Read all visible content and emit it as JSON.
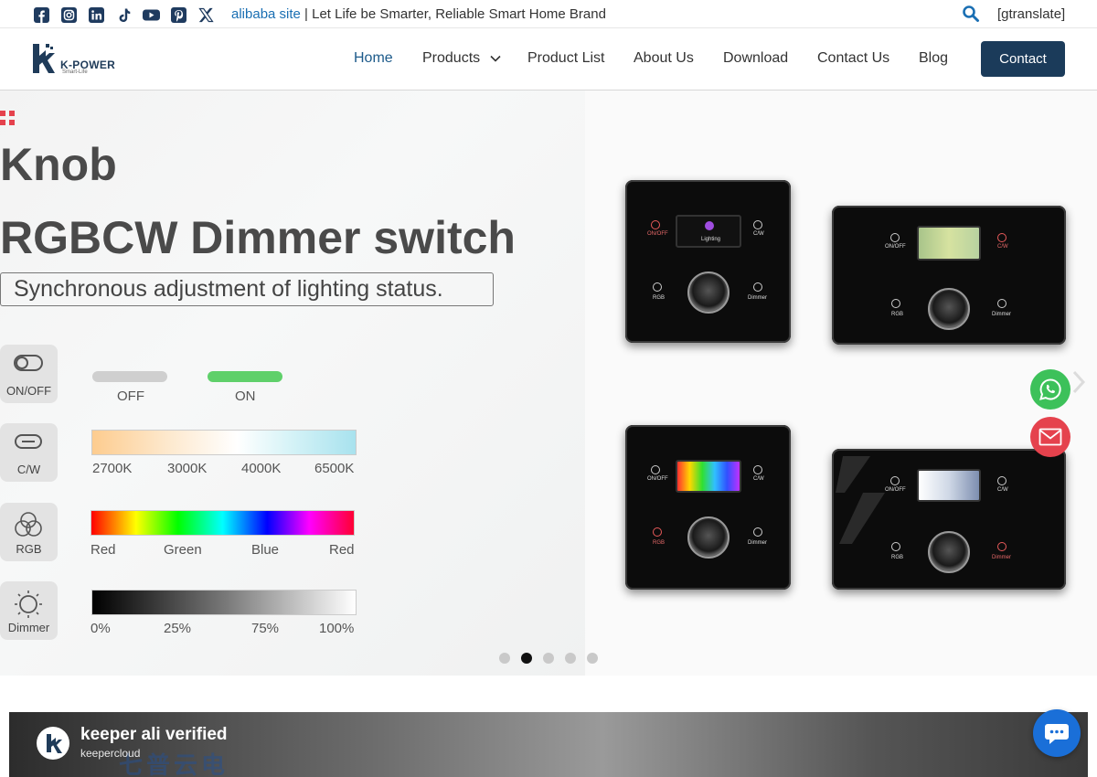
{
  "topbar": {
    "social_icons": [
      "facebook-icon",
      "instagram-icon",
      "linkedin-icon",
      "tiktok-icon",
      "youtube-icon",
      "pinterest-icon",
      "x-icon"
    ],
    "link_text": "alibaba site",
    "separator": " | ",
    "tagline": "Let Life be Smarter, Reliable Smart Home Brand",
    "translate": "[gtranslate]"
  },
  "header": {
    "logo_text": "K-POWER",
    "logo_sub": "Smart-Life",
    "nav": [
      "Home",
      "Products",
      "Product List",
      "About Us",
      "Download",
      "Contact Us",
      "Blog"
    ],
    "active_nav": "Home",
    "contact_button": "Contact"
  },
  "hero": {
    "line1": "Knob",
    "line2": "RGBCW Dimmer switch",
    "subtitle": "Synchronous adjustment of lighting status.",
    "features": [
      {
        "label": "ON/OFF"
      },
      {
        "label": "C/W"
      },
      {
        "label": "RGB"
      },
      {
        "label": "Dimmer"
      }
    ],
    "onoff": {
      "off": "OFF",
      "on": "ON"
    },
    "cw_ticks": [
      "2700K",
      "3000K",
      "4000K",
      "6500K"
    ],
    "rgb_ticks": [
      "Red",
      "Green",
      "Blue",
      "Red"
    ],
    "dim_ticks": [
      "0%",
      "25%",
      "75%",
      "100%"
    ],
    "panel_labels": {
      "onoff": "ON/OFF",
      "cw": "C/W",
      "rgb": "RGB",
      "dimmer": "Dimmer",
      "lighting": "Lighting"
    },
    "carousel_active_index": 1,
    "carousel_count": 5
  },
  "video": {
    "title": "keeper ali verified",
    "channel": "keepercloud",
    "bg_text": "七普云电"
  },
  "colors": {
    "accent": "#1b3b5a",
    "link": "#1a6fb3",
    "whatsapp": "#3dc15a",
    "email": "#e5424d",
    "chat": "#1a6fd8"
  }
}
